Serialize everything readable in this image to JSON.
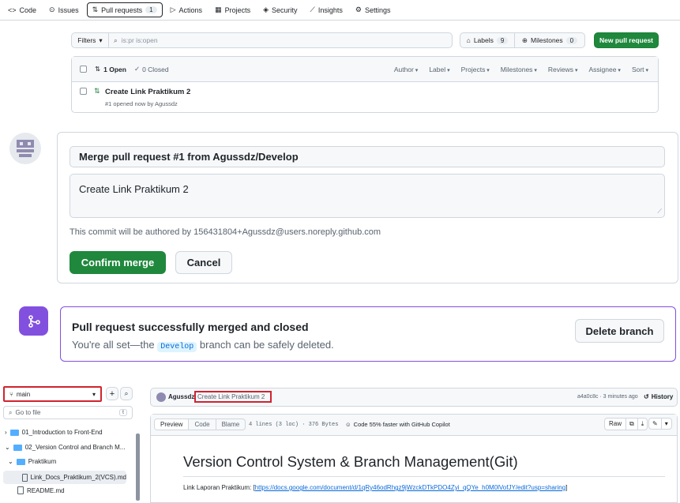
{
  "nav": {
    "code": "Code",
    "issues": "Issues",
    "pull_requests": "Pull requests",
    "pull_requests_count": "1",
    "actions": "Actions",
    "projects": "Projects",
    "security": "Security",
    "insights": "Insights",
    "settings": "Settings"
  },
  "pr_list": {
    "filters_button": "Filters",
    "search_value": "is:pr is:open",
    "labels": "Labels",
    "labels_count": "9",
    "milestones": "Milestones",
    "milestones_count": "0",
    "new_pr": "New pull request",
    "open_count": "1 Open",
    "closed_count": "0 Closed",
    "filter_headers": [
      "Author",
      "Label",
      "Projects",
      "Milestones",
      "Reviews",
      "Assignee",
      "Sort"
    ],
    "items": [
      {
        "title": "Create Link Praktikum 2",
        "meta": "#1 opened now by Agussdz"
      }
    ]
  },
  "merge_form": {
    "commit_title": "Merge pull request #1 from Agussdz/Develop",
    "commit_message": "Create Link Praktikum 2",
    "author_note": "This commit will be authored by 156431804+Agussdz@users.noreply.github.com",
    "confirm": "Confirm merge",
    "cancel": "Cancel"
  },
  "merged": {
    "title": "Pull request successfully merged and closed",
    "desc_before": "You're all set—the",
    "branch": "Develop",
    "desc_after": "branch can be safely deleted.",
    "delete_branch": "Delete branch"
  },
  "file_tree": {
    "branch": "main",
    "go_to_file": "Go to file",
    "go_to_file_shortcut": "t",
    "items": [
      "01_Introduction to Front-End",
      "02_Version Control and Branch M...",
      "Praktikum",
      "Link_Docs_Praktikum_2(VCS).md",
      "README.md"
    ]
  },
  "file_view": {
    "author": "Agussdz",
    "commit_message": "Create Link Praktikum 2",
    "commit_meta": "a4a0c8c · 3 minutes ago",
    "history": "History",
    "tabs": [
      "Preview",
      "Code",
      "Blame"
    ],
    "file_info": "4 lines (3 loc) · 376 Bytes",
    "copilot": "Code 55% faster with GitHub Copilot",
    "raw": "Raw",
    "heading": "Version Control System & Branch Management(Git)",
    "link_label": "Link Laporan Praktikum: [",
    "link_url": "https://docs.google.com/document/d/1qRy46odRhgz9jWzckDTkPDO4Zyi_qQYe_h0M0lVofJY/edit?usp=sharing",
    "link_close": "]"
  },
  "colors": {
    "green": "#1f883d",
    "purple": "#8250df",
    "link": "#0969da",
    "highlight_red": "#d1242f"
  }
}
